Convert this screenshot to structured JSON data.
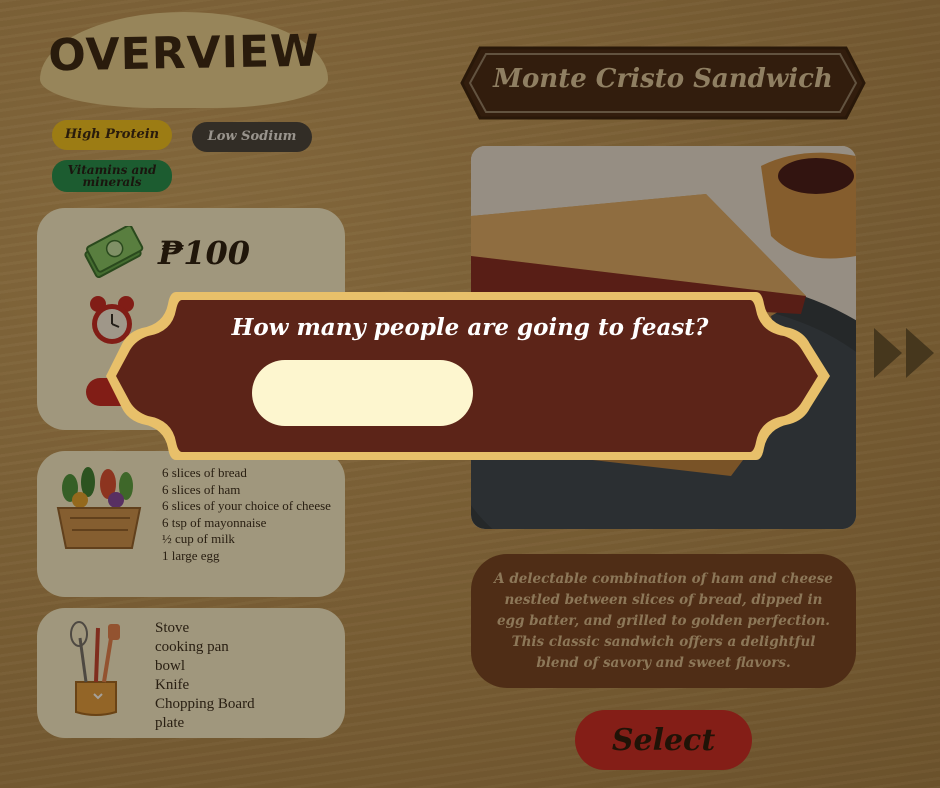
{
  "overview": {
    "title": "OVERVIEW",
    "tags": {
      "high_protein": "High Protein",
      "low_sodium": "Low Sodium",
      "vitamins": "Vitamins and minerals"
    },
    "price": "₱100",
    "ingredients": [
      "6 slices of bread",
      "6 slices of ham",
      "6 slices of your choice of cheese",
      "6 tsp of mayonnaise",
      "½ cup of milk",
      "1 large egg"
    ],
    "tools": [
      "Stove",
      "cooking pan",
      "bowl",
      "Knife",
      "Chopping Board",
      "plate"
    ]
  },
  "dish": {
    "title": "Monte Cristo Sandwich",
    "description": "A delectable combination of ham and cheese nestled between slices of bread, dipped in egg batter, and grilled to golden perfection. This classic sandwich offers a delightful blend of savory and sweet flavors.",
    "select_label": "Select"
  },
  "modal": {
    "question": "How many people are going to feast?",
    "input_value": "",
    "input_placeholder": ""
  },
  "icons": {
    "money": "money-icon",
    "clock": "alarm-clock-icon",
    "basket": "vegetable-basket-icon",
    "utensils": "utensils-icon",
    "next": "next-arrow-icon"
  },
  "colors": {
    "background": "#9c7a45",
    "card": "#f7efcf",
    "modal": "#5c2418",
    "modal_border": "#e8c06a",
    "select_button": "#c71f1f",
    "high_protein": "#f0c21a",
    "low_sodium": "#3a3a3a",
    "vitamins": "#138a4a"
  }
}
